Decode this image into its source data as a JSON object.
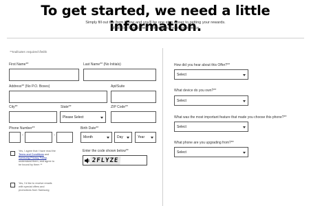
{
  "header": {
    "title": "To get started, we need a little information.",
    "subtitle_line1": "Simply fill out the form below and you'll be one step closer to getting your rewards.",
    "subtitle_line2": "We'd also love to hear a little about your experience."
  },
  "form": {
    "required_note": "**Indicates required fields",
    "first_name_label": "First Name**",
    "last_name_label": "Last Name** (No Initials)",
    "address_label": "Address** (No P.O. Boxes)",
    "apt_label": "Apt/Suite",
    "city_label": "City**",
    "state_label": "State**",
    "state_value": "Please Select",
    "zip_label": "ZIP Code**",
    "phone_label": "Phone Number**",
    "phone_dash": "-",
    "birth_label": "Birth Date**",
    "month_value": "Month",
    "day_value": "Day",
    "year_value": "Year",
    "consent1_prefix": "Yes, I agree that I have read the",
    "terms_link": "Terms and Conditions",
    "consent1_and": "and",
    "privacy_link": "Samsung Privacy Policy",
    "consent1_suffix": ", understand them, and agree to be bound by them **",
    "consent2": "Yes, I'd like to receive emails with special offers and promotions from Samsung",
    "captcha_label": "Enter the code shown below**",
    "captcha_code": "2FLYZE"
  },
  "survey": {
    "q1_label": "How did you hear about this Offer?**",
    "q1_value": "Select",
    "q2_label": "What device do you own?**",
    "q2_value": "Select",
    "q3_label": "What was the most important feature that made you choose this phone?**",
    "q3_value": "Select",
    "q4_label": "What phone are you upgrading from?**",
    "q4_value": "Select"
  }
}
